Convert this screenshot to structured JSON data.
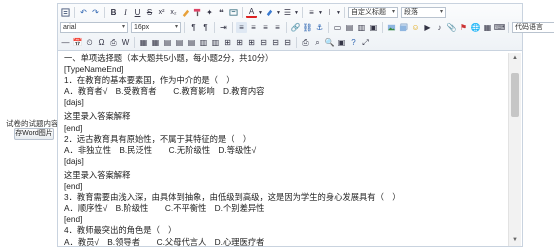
{
  "form": {
    "label": "试卷的试题内容:",
    "upload_button": "存Word图片"
  },
  "toolbar": {
    "font_family": "arial",
    "font_size": "16px",
    "custom_title": "自定义标题",
    "paragraph": "段落",
    "code_language": "代码语言"
  },
  "content": {
    "lines": [
      "一、单项选择题（本大题共5小题，每小题2分，共10分）",
      "[TypeNameEnd]",
      "1．在教育的基本要素国，作为中介的是（　）",
      "A．教育者√　B.受教育者　　C.教育影响　D.教育内容",
      "[dajs]",
      "这里录入答案解释",
      "[end]",
      "2．远古教育具有原始性，不属于其特征的是（　）",
      "A．非独立性　B.民泛性　　C.无阶级性　D.等级性√",
      "[dajs]",
      "这里录入答案解释",
      " [end]",
      "3．教育需要由浅入深，由具体到抽象，由低级到高级，这是因为学生的身心发展具有（　）",
      "A．顺序性√　B.阶级性　　C.不平衡性　D.个别差异性",
      "[end]",
      "4．教师最突出的角色是（　）",
      "A．教员√　B.领导者　　C.父母代言人　D.心理医疗者"
    ]
  }
}
